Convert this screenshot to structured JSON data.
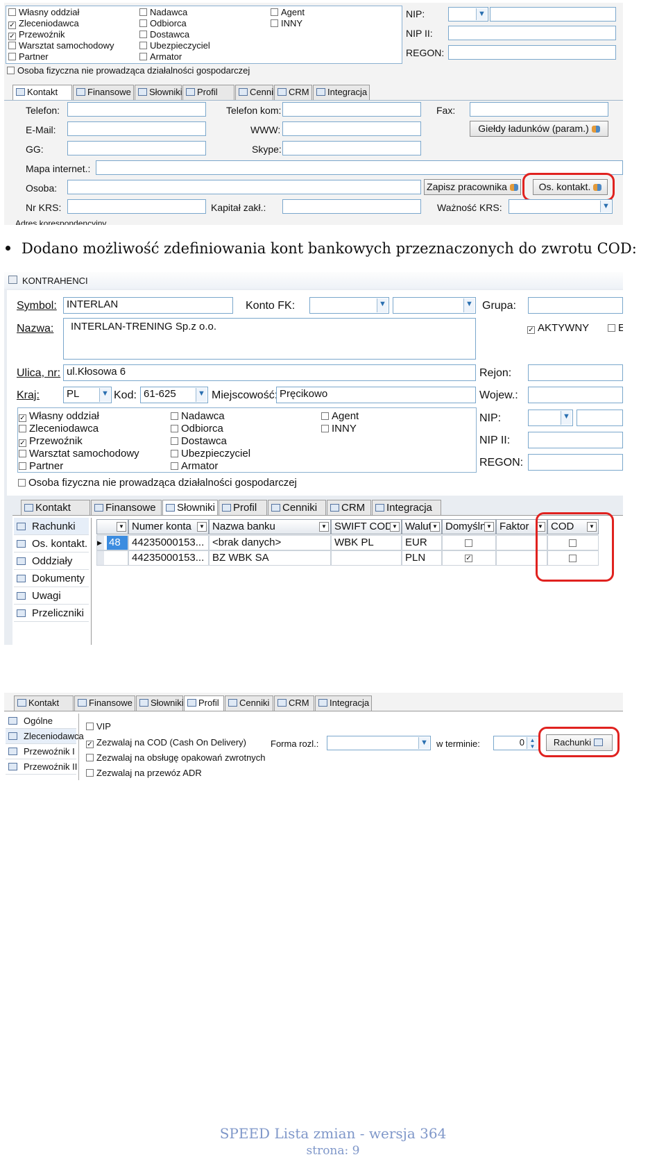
{
  "s1": {
    "col1": [
      "Własny oddział",
      "Zleceniodawca",
      "Przewoźnik",
      "Warsztat samochodowy",
      "Partner"
    ],
    "col1_checked": [
      false,
      true,
      true,
      false,
      false
    ],
    "col2": [
      "Nadawca",
      "Odbiorca",
      "Dostawca",
      "Ubezpieczyciel",
      "Armator"
    ],
    "col3": [
      "Agent",
      "INNY"
    ],
    "nip": "NIP:",
    "nip2": "NIP II:",
    "regon": "REGON:",
    "osoba_fiz": "Osoba fizyczna nie prowadząca działalności gospodarczej",
    "tabs": [
      "Kontakt",
      "Finansowe",
      "Słowniki",
      "Profil",
      "Cenniki",
      "CRM",
      "Integracja"
    ],
    "telefon": "Telefon:",
    "telefon_kom": "Telefon kom:",
    "fax": "Fax:",
    "email": "E-Mail:",
    "www": "WWW:",
    "gieldy": "Giełdy ładunków (param.)",
    "gg": "GG:",
    "skype": "Skype:",
    "mapa": "Mapa internet.:",
    "osoba": "Osoba:",
    "zapisz": "Zapisz pracownika",
    "os_kontakt": "Os. kontakt.",
    "nr_krs": "Nr KRS:",
    "kapital": "Kapitał zakł.:",
    "waznosc": "Ważność KRS:",
    "adres": "Adres korespondencyjny"
  },
  "bullet": "Dodano możliwość zdefiniowania kont bankowych przeznaczonych do zwrotu COD:",
  "s2": {
    "title": "KONTRAHENCI",
    "symbol_lbl": "Symbol:",
    "symbol": "INTERLAN",
    "konto_fk": "Konto FK:",
    "grupa": "Grupa:",
    "nazwa_lbl": "Nazwa:",
    "nazwa": "INTERLAN-TRENING Sp.z o.o.",
    "aktywny": "AKTYWNY",
    "e_cut": "E",
    "ulica_lbl": "Ulica, nr:",
    "ulica": "ul.Kłosowa 6",
    "rejon": "Rejon:",
    "kraj_lbl": "Kraj:",
    "kraj": "PL",
    "kod_lbl": "Kod:",
    "kod": "61-625",
    "miejsc_lbl": "Miejscowość:",
    "miejsc": "Pręcikowo",
    "wojew": "Wojew.:",
    "nip": "NIP:",
    "nip2": "NIP II:",
    "regon": "REGON:",
    "col1": [
      "Własny oddział",
      "Zleceniodawca",
      "Przewoźnik",
      "Warsztat samochodowy",
      "Partner"
    ],
    "col1_checked": [
      true,
      false,
      true,
      false,
      false
    ],
    "col2": [
      "Nadawca",
      "Odbiorca",
      "Dostawca",
      "Ubezpieczyciel",
      "Armator"
    ],
    "col3": [
      "Agent",
      "INNY"
    ],
    "osoba_fiz": "Osoba fizyczna nie prowadząca działalności gospodarczej",
    "tabs": [
      "Kontakt",
      "Finansowe",
      "Słowniki",
      "Profil",
      "Cenniki",
      "CRM",
      "Integracja"
    ],
    "side": [
      "Rachunki",
      "Os. kontakt.",
      "Oddziały",
      "Dokumenty",
      "Uwagi",
      "Przeliczniki"
    ],
    "columns": [
      "Numer konta",
      "Nazwa banku",
      "SWIFT COD",
      "Walut",
      "Domyśln",
      "Faktor",
      "COD"
    ],
    "rows": [
      {
        "id": "48",
        "konto": "44235000153...",
        "bank": "<brak danych>",
        "swift": "WBK PL",
        "waluta": "EUR",
        "domyslny": false,
        "cod": false
      },
      {
        "id": "",
        "konto": "44235000153...",
        "bank": "BZ WBK SA",
        "swift": "",
        "waluta": "PLN",
        "domyslny": true,
        "cod": false
      }
    ]
  },
  "s3": {
    "tabs": [
      "Kontakt",
      "Finansowe",
      "Słowniki",
      "Profil",
      "Cenniki",
      "CRM",
      "Integracja"
    ],
    "side": [
      "Ogólne",
      "Zleceniodawca",
      "Przewoźnik I",
      "Przewoźnik II"
    ],
    "vip": "VIP",
    "cod": "Zezwalaj na COD (Cash On Delivery)",
    "opak": "Zezwalaj na obsługę opakowań zwrotnych",
    "adr": "Zezwalaj na przewóz ADR",
    "forma": "Forma rozl.:",
    "termin": "w terminie:",
    "termin_val": "0",
    "rachunki": "Rachunki"
  },
  "footer": {
    "title": "SPEED Lista zmian - wersja 364",
    "page": "strona: 9"
  }
}
